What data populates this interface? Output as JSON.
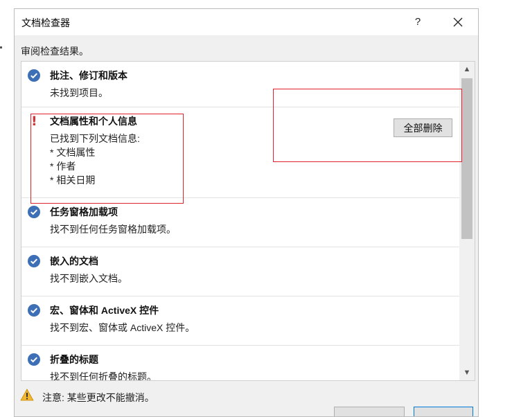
{
  "window": {
    "title": "文档检查器",
    "help_label": "?"
  },
  "instruction": "审阅检查结果。",
  "results": [
    {
      "status": "ok",
      "title": "批注、修订和版本",
      "description": [
        "未找到项目。"
      ]
    },
    {
      "status": "warning",
      "title": "文档属性和个人信息",
      "description": [
        "已找到下列文档信息:",
        "* 文档属性",
        "* 作者",
        "* 相关日期"
      ],
      "action_label": "全部删除"
    },
    {
      "status": "ok",
      "title": "任务窗格加载项",
      "description": [
        "找不到任何任务窗格加载项。"
      ]
    },
    {
      "status": "ok",
      "title": "嵌入的文档",
      "description": [
        "找不到嵌入文档。"
      ]
    },
    {
      "status": "ok",
      "title": "宏、窗体和 ActiveX 控件",
      "description": [
        "找不到宏、窗体或 ActiveX 控件。"
      ]
    },
    {
      "status": "ok",
      "title": "折叠的标题",
      "description": [
        "找不到任何折叠的标题。"
      ]
    }
  ],
  "footer": {
    "note": "注意: 某些更改不能撤消。"
  },
  "colors": {
    "ok_icon": "#3c6fb5",
    "warning": "#d13438",
    "annotation": "#e0202a",
    "caution_icon": "#f2b630"
  },
  "icons": {
    "ok": "checkmark-circle-icon",
    "warning": "exclamation-icon",
    "footer": "warning-triangle-icon",
    "close": "close-icon"
  }
}
